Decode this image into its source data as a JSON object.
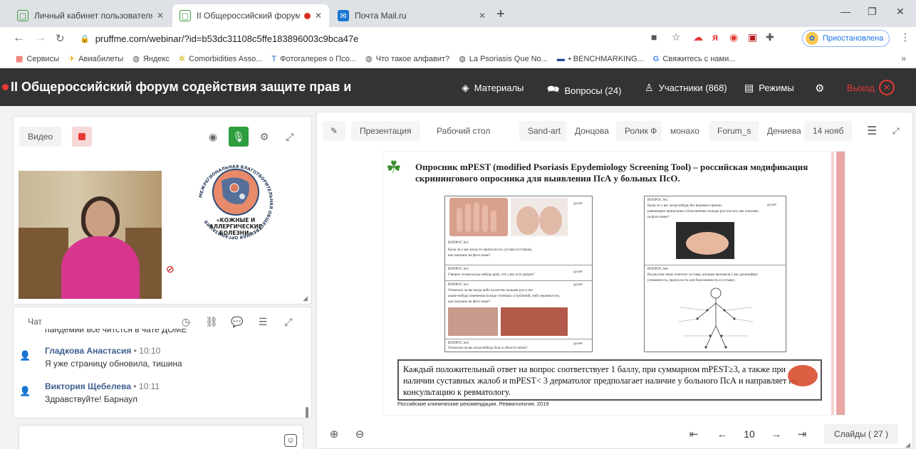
{
  "browser": {
    "tabs": [
      {
        "title": "Личный кабинет пользователя",
        "close": "✕"
      },
      {
        "title": "II Общероссийский форум",
        "close": "✕"
      },
      {
        "title": "Почта Mail.ru",
        "close": "✕"
      }
    ],
    "new_tab": "+",
    "window_controls": [
      "—",
      "❐",
      "✕"
    ],
    "url": "pruffme.com/webinar/?id=b53dc31108c5ffe183896003c9bca47e",
    "profile_label": "Приостановлена",
    "bookmarks": [
      "Сервисы",
      "Авиабилеты",
      "Яндекс",
      "Comorbidities Asso...",
      "Фотогалерея о Псо...",
      "Что такое алфавит?",
      "La Psoriasis Que No...",
      "• BENCHMARKING...",
      "Свяжитесь с нами..."
    ],
    "bookmarks_more": "»"
  },
  "app": {
    "title": "II Общероссийский форум содействия защите прав и",
    "nav": {
      "materials": "Материалы",
      "questions": "Вопросы (24)",
      "participants": "Участники (868)",
      "modes": "Режимы"
    },
    "exit": "Выход",
    "accent": "#e53935"
  },
  "video_panel": {
    "label": "Видео"
  },
  "logo": {
    "ring_text": "МЕЖРЕГИОНАЛЬНАЯ БЛАГОТВОРИТЕЛЬНАЯ ОБЩЕСТВЕННАЯ ОРГАНИЗАЦИЯ",
    "line1": "«КОЖНЫЕ И",
    "line2": "АЛЛЕРГИЧЕСКИЕ",
    "line3": "БОЛЕЗНИ»"
  },
  "chat": {
    "label": "Чат",
    "cut_text": "пандемии все читстся в чате ДОМЕ",
    "messages": [
      {
        "author": "Гладкова Анастасия",
        "time": "• 10:10",
        "text": "Я уже страницу обновила, тишина"
      },
      {
        "author": "Виктория Щебелева",
        "time": "• 10:11",
        "text": "Здравствуйте! Барнаул"
      }
    ],
    "emoji": "☺"
  },
  "presentation": {
    "tabs": [
      "Презентация",
      "Рабочий стол",
      "Sand-art",
      "Донцова",
      "Ролик Ф",
      "монахо",
      "Forum_s",
      "Дениева",
      "14 нояб"
    ],
    "slide": {
      "title": "Опросник mPEST (modified Psoriasis Epydemiology Screening Tool) – российская модификация скринингового опросника для выявления ПсА у больных ПсО.",
      "yes_no": "да нет",
      "q1_label": "ВОПРОС №1",
      "q1_text_1": "Была ли у вас когда-то припухлость сустава (суставов),",
      "q1_text_2": "как показано на фото ниже?",
      "q2_label": "ВОПРОС №2",
      "q2_text": "Говорил ли вам когда-нибудь врач, что у вас есть артрит?",
      "q3_label": "ВОПРОС №3",
      "q3_text_1": "Отмечали ли вы когда-либо на ногтях пальцев рук и ног",
      "q3_text_2": "какие-нибудь изменения (в виде точечных углублений, либо неровности),",
      "q3_text_3": "как показано на фото ниже?",
      "q4_label": "ВОПРОС №4",
      "q4_text": "Отмечали ли вы когда-нибудь боль в области пятки?",
      "q5_label": "ВОПРОС №5",
      "q5_text_1": "Были ли у вас когда-нибудь без видимых причин",
      "q5_text_2": "равномерно припухшие и болезненные пальцы рук или ног, как показано",
      "q5_text_3": "на фото ниже?",
      "q6_label": "ВОПРОС №6",
      "q6_text_1": "На рисунке ниже отметьте суставы, которые вызывали у вас дискомфорт",
      "q6_text_2": "(скованность, припухлость или болезненность в суставе).",
      "conclusion": "Каждый положительный ответ на вопрос соответствует 1 баллу, при суммарном mPEST≥3, а также при наличии суставных жалоб и mPEST< 3  дерматолог предполагает наличие у больного ПсА и направляет на консультацию к ревматологу.",
      "footer": "Российские клинические рекомендации. Ревматология. 2019"
    },
    "controls": {
      "page": "10",
      "slides_count": "Слайды ( 27 )"
    }
  }
}
